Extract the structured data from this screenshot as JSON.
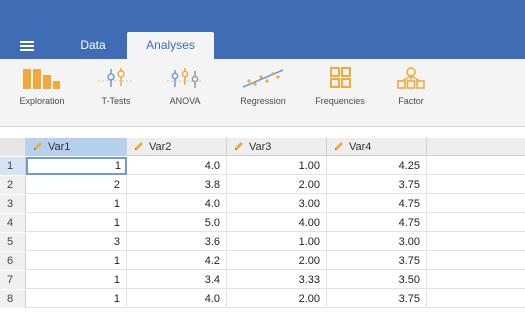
{
  "header": {
    "tabs": [
      {
        "label": "Data"
      },
      {
        "label": "Analyses"
      }
    ]
  },
  "ribbon": {
    "buttons": [
      {
        "label": "Exploration",
        "icon": "exploration-icon"
      },
      {
        "label": "T-Tests",
        "icon": "t-tests-icon"
      },
      {
        "label": "ANOVA",
        "icon": "anova-icon"
      },
      {
        "label": "Regression",
        "icon": "regression-icon"
      },
      {
        "label": "Frequencies",
        "icon": "frequencies-icon"
      },
      {
        "label": "Factor",
        "icon": "factor-icon"
      }
    ]
  },
  "sheet": {
    "columns": [
      "Var1",
      "Var2",
      "Var3",
      "Var4"
    ],
    "rows": [
      {
        "n": "1",
        "cells": [
          "1",
          "4.0",
          "1.00",
          "4.25"
        ]
      },
      {
        "n": "2",
        "cells": [
          "2",
          "3.8",
          "2.00",
          "3.75"
        ]
      },
      {
        "n": "3",
        "cells": [
          "1",
          "4.0",
          "3.00",
          "4.75"
        ]
      },
      {
        "n": "4",
        "cells": [
          "1",
          "5.0",
          "4.00",
          "4.75"
        ]
      },
      {
        "n": "5",
        "cells": [
          "3",
          "3.6",
          "1.00",
          "3.00"
        ]
      },
      {
        "n": "6",
        "cells": [
          "1",
          "4.2",
          "2.00",
          "3.75"
        ]
      },
      {
        "n": "7",
        "cells": [
          "1",
          "3.4",
          "3.33",
          "3.50"
        ]
      },
      {
        "n": "8",
        "cells": [
          "1",
          "4.0",
          "2.00",
          "3.75"
        ]
      }
    ]
  },
  "colors": {
    "header_blue": "#3e6db5",
    "icon_orange": "#f2a93b",
    "icon_blue": "#6c9bd6",
    "selected_header": "#b7d0ee"
  }
}
